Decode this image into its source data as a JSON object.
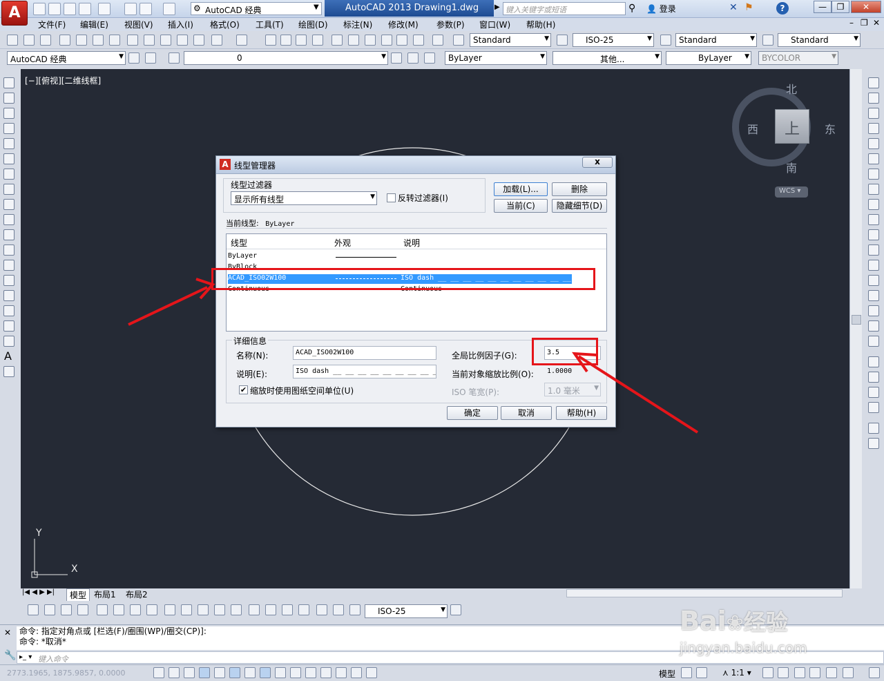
{
  "app": {
    "logo": "A",
    "workspace": "AutoCAD 经典",
    "title": "AutoCAD 2013    Drawing1.dwg",
    "search_placeholder": "键入关键字或短语",
    "login": "登录",
    "help": "?"
  },
  "window": {
    "minimize": "—",
    "restore": "❐",
    "close": "✕"
  },
  "menus": [
    "文件(F)",
    "编辑(E)",
    "视图(V)",
    "插入(I)",
    "格式(O)",
    "工具(T)",
    "绘图(D)",
    "标注(N)",
    "修改(M)",
    "参数(P)",
    "窗口(W)",
    "帮助(H)"
  ],
  "toolbar_styles": {
    "text_style": "Standard",
    "dim_style": "ISO-25",
    "table_style": "Standard",
    "mleader_style": "Standard"
  },
  "toolbar_layers": {
    "workspace": "AutoCAD 经典",
    "layer": "0",
    "color": "ByLayer",
    "linetype": "其他...",
    "lineweight": "ByLayer",
    "plotstyle": "BYCOLOR"
  },
  "viewport": {
    "label": "[−][俯视][二维线框]"
  },
  "viewcube": {
    "north": "北",
    "south": "南",
    "east": "东",
    "west": "西",
    "top": "上",
    "wcs": "WCS"
  },
  "ucs": {
    "x": "X",
    "y": "Y"
  },
  "tabs": [
    "模型",
    "布局1",
    "布局2"
  ],
  "dim_toolbar": {
    "dim_style": "ISO-25"
  },
  "command": {
    "lines": [
      "命令: 指定对角点或 [栏选(F)/圈围(WP)/圈交(CP)]:",
      "命令: *取消*"
    ],
    "placeholder": "键入命令"
  },
  "status": {
    "coords": "2773.1965, 1875.9857, 0.0000",
    "model": "模型",
    "scale": "1:1"
  },
  "dialog": {
    "title": "线型管理器",
    "filter_group": "线型过滤器",
    "filter_value": "显示所有线型",
    "invert_label": "反转过滤器(I)",
    "buttons": {
      "load": "加载(L)...",
      "delete": "删除",
      "current": "当前(C)",
      "hide_details": "隐藏细节(D)",
      "ok": "确定",
      "cancel": "取消",
      "help": "帮助(H)"
    },
    "current_label": "当前线型:",
    "current_value": "ByLayer",
    "columns": [
      "线型",
      "外观",
      "说明"
    ],
    "rows": [
      {
        "name": "ByLayer",
        "desc": ""
      },
      {
        "name": "ByBlock",
        "desc": ""
      },
      {
        "name": "ACAD_ISO02W100",
        "desc": "ISO dash __ __ __ __ __ __ __ __ __ __ __"
      },
      {
        "name": "Continuous",
        "desc": "Continuous"
      }
    ],
    "details_group": "详细信息",
    "name_label": "名称(N):",
    "name_value": "ACAD_ISO02W100",
    "desc_label": "说明(E):",
    "desc_value": "ISO dash __ __ __ __ __ __ __ __ __ __ __",
    "paper_units_label": "缩放时使用图纸空间单位(U)",
    "global_scale_label": "全局比例因子(G):",
    "global_scale_value": "3.5",
    "current_scale_label": "当前对象缩放比例(O):",
    "current_scale_value": "1.0000",
    "pen_width_label": "ISO 笔宽(P):",
    "pen_width_value": "1.0 毫米"
  },
  "watermark": {
    "brand": "Bai",
    "brand2": "经验",
    "url": "jingyan.baidu.com"
  },
  "colors": {
    "canvas": "#252a35",
    "highlight": "#3399ff",
    "annotation": "#e5151a"
  }
}
